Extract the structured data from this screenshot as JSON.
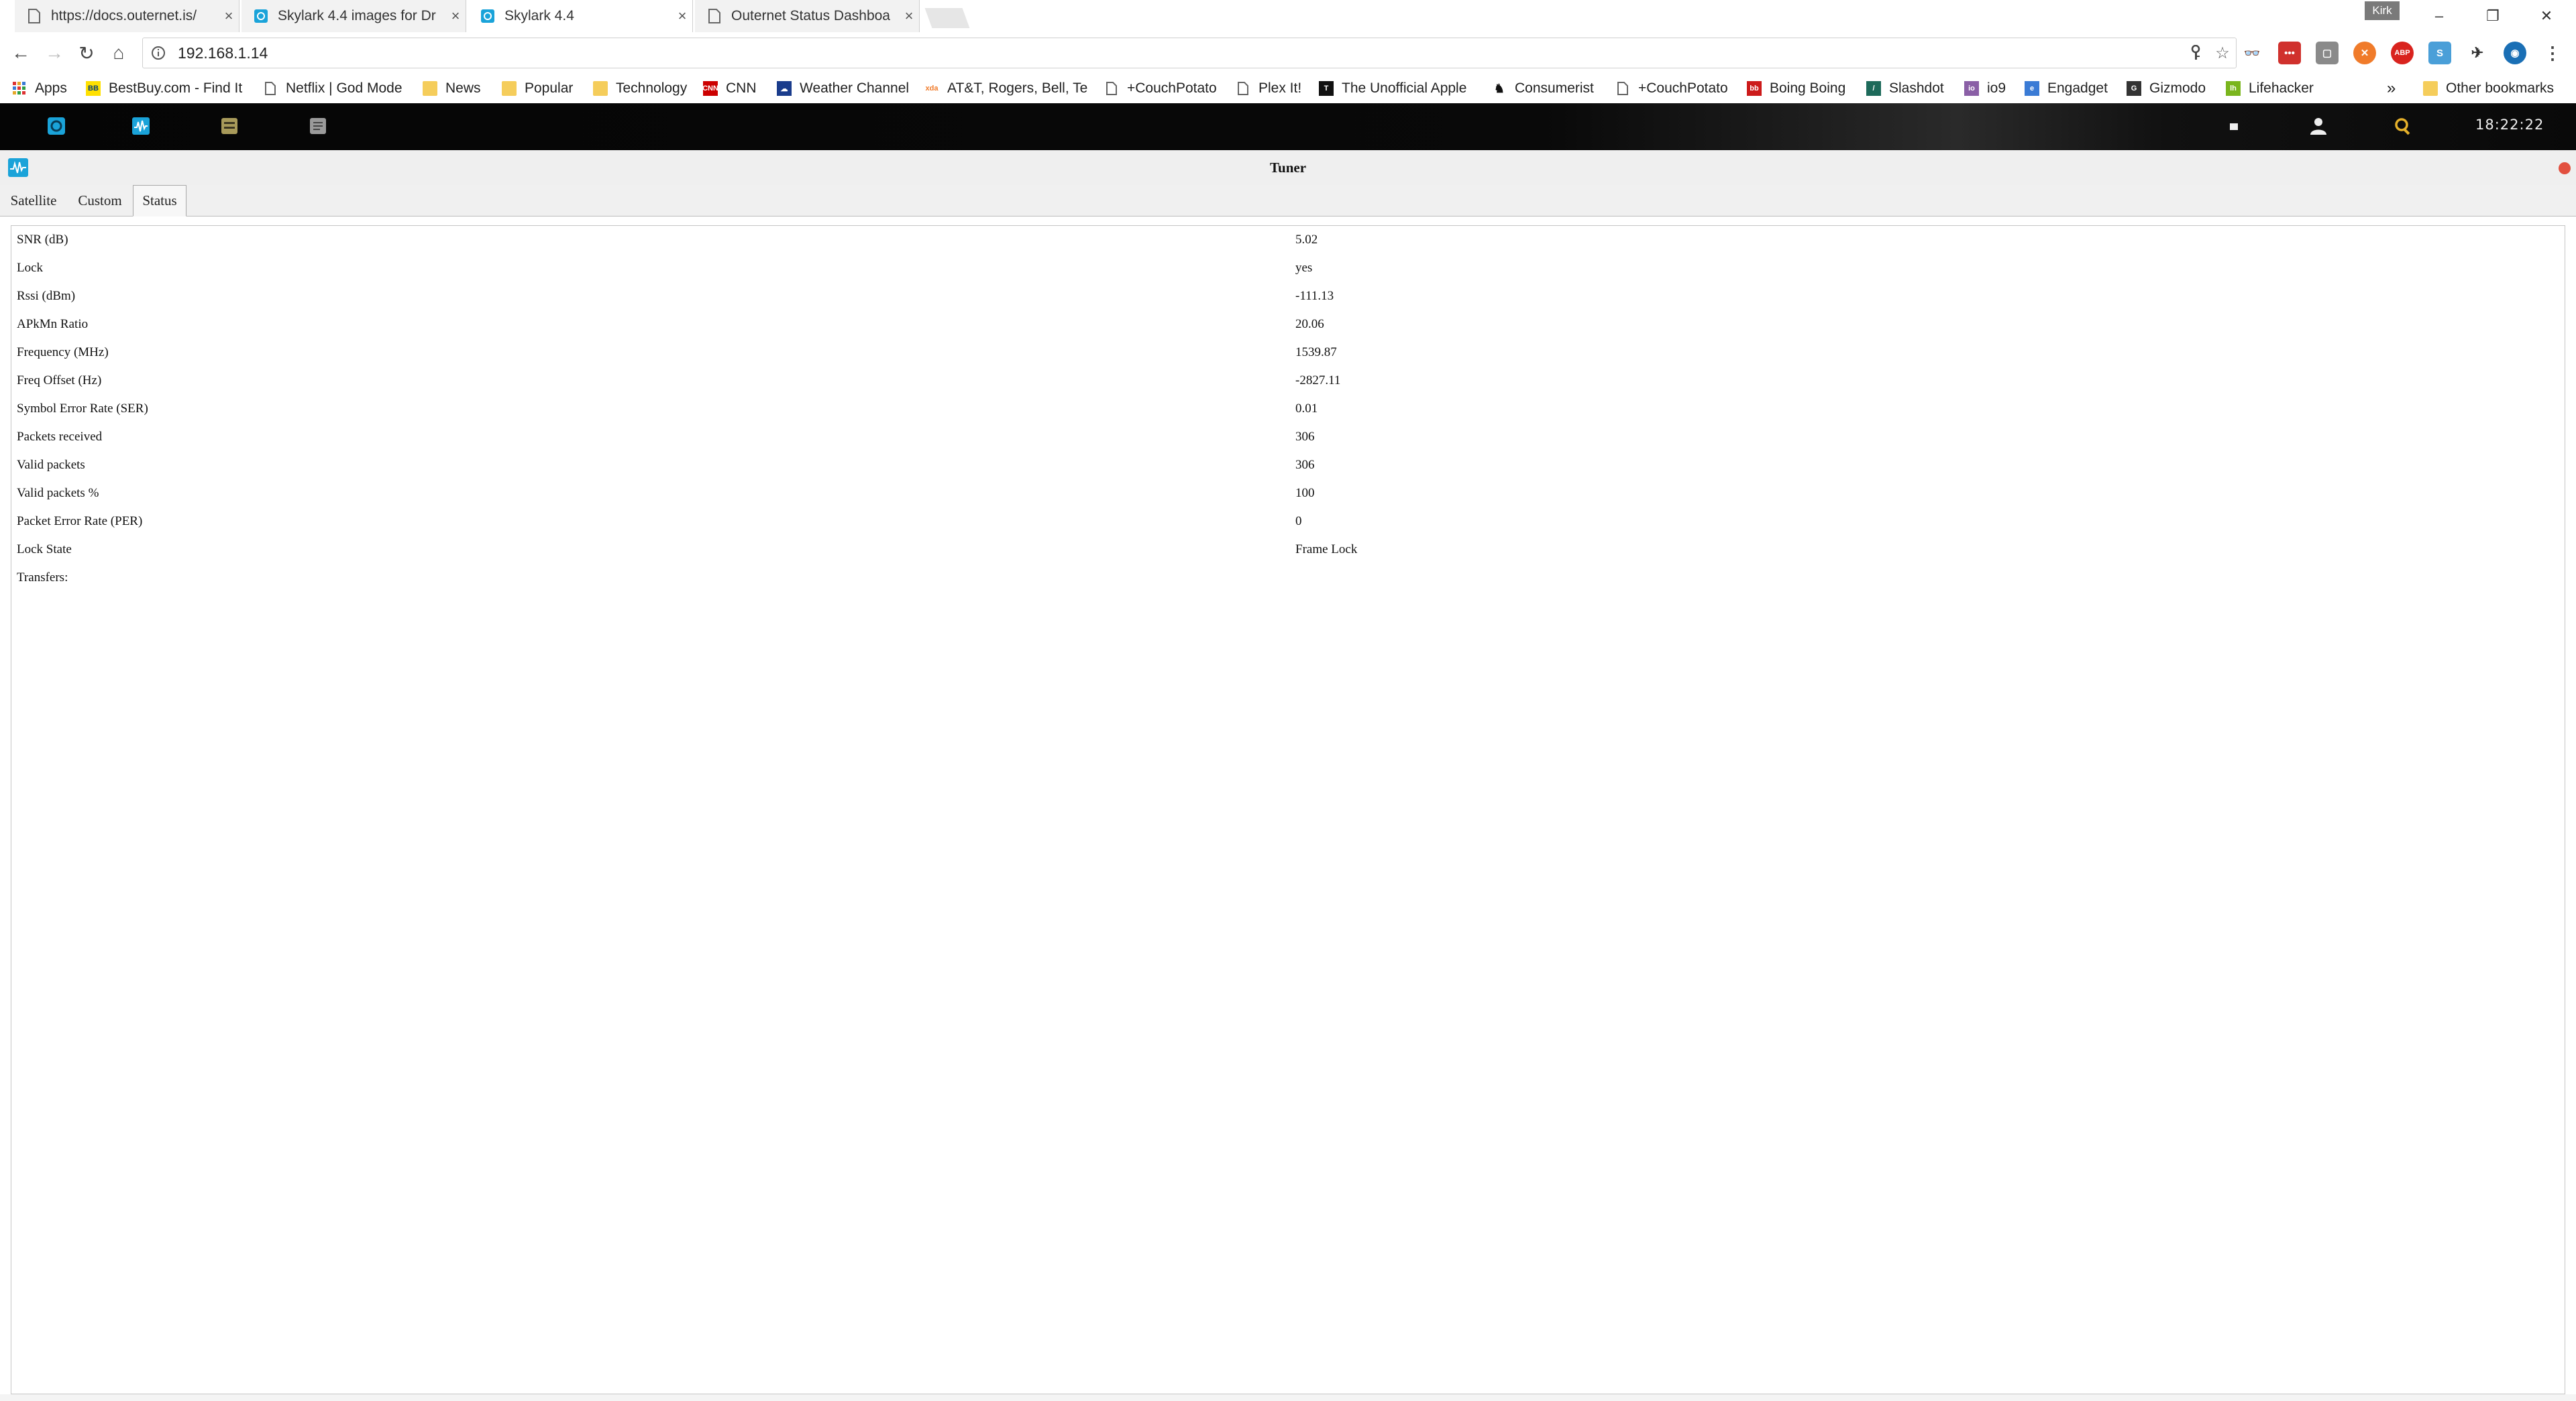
{
  "browser": {
    "tabs": [
      {
        "title": "https://docs.outernet.is/",
        "icon": "page-icon",
        "active": false
      },
      {
        "title": "Skylark 4.4 images for Dr",
        "icon": "skylark-icon",
        "active": false
      },
      {
        "title": "Skylark 4.4",
        "icon": "skylark-icon",
        "active": true
      },
      {
        "title": "Outernet Status Dashboa",
        "icon": "page-icon",
        "active": false
      }
    ],
    "profile_label": "Kirk",
    "address": "192.168.1.14",
    "bookmarks": [
      {
        "label": "Apps",
        "icon": "apps-grid-icon"
      },
      {
        "label": "BestBuy.com - Find It",
        "icon": "bestbuy-icon"
      },
      {
        "label": "Netflix | God Mode",
        "icon": "page-icon"
      },
      {
        "label": "News",
        "icon": "folder-icon"
      },
      {
        "label": "Popular",
        "icon": "folder-icon"
      },
      {
        "label": "Technology",
        "icon": "folder-icon"
      },
      {
        "label": "CNN",
        "icon": "cnn-icon"
      },
      {
        "label": "Weather Channel",
        "icon": "weather-icon"
      },
      {
        "label": "AT&T, Rogers, Bell, Te",
        "icon": "xda-icon"
      },
      {
        "label": "+CouchPotato",
        "icon": "page-icon"
      },
      {
        "label": "Plex It!",
        "icon": "page-icon"
      },
      {
        "label": "The Unofficial Apple",
        "icon": "apple-icon"
      },
      {
        "label": "Consumerist",
        "icon": "consumerist-icon"
      },
      {
        "label": "+CouchPotato",
        "icon": "page-icon"
      },
      {
        "label": "Boing Boing",
        "icon": "boingboing-icon"
      },
      {
        "label": "Slashdot",
        "icon": "slashdot-icon"
      },
      {
        "label": "io9",
        "icon": "io9-icon"
      },
      {
        "label": "Engadget",
        "icon": "engadget-icon"
      },
      {
        "label": "Gizmodo",
        "icon": "gizmodo-icon"
      },
      {
        "label": "Lifehacker",
        "icon": "lifehacker-icon"
      }
    ],
    "overflow_label": "»",
    "other_bookmarks": "Other bookmarks"
  },
  "appbar": {
    "clock": "18:22:22",
    "icons": [
      "home-icon",
      "tuner-icon",
      "files-icon",
      "notes-icon",
      "wifi-icon",
      "user-icon",
      "search-icon"
    ]
  },
  "tuner": {
    "title": "Tuner",
    "tabs": [
      "Satellite",
      "Custom",
      "Status"
    ],
    "active_tab": "Status",
    "rows": [
      {
        "label": "SNR (dB)",
        "value": "5.02"
      },
      {
        "label": "Lock",
        "value": "yes"
      },
      {
        "label": "Rssi (dBm)",
        "value": "-111.13"
      },
      {
        "label": "APkMn Ratio",
        "value": "20.06"
      },
      {
        "label": "Frequency (MHz)",
        "value": "1539.87"
      },
      {
        "label": "Freq Offset (Hz)",
        "value": "-2827.11"
      },
      {
        "label": "Symbol Error Rate (SER)",
        "value": "0.01"
      },
      {
        "label": "Packets received",
        "value": "306"
      },
      {
        "label": "Valid packets",
        "value": "306"
      },
      {
        "label": "Valid packets %",
        "value": "100"
      },
      {
        "label": "Packet Error Rate (PER)",
        "value": "0"
      },
      {
        "label": "Lock State",
        "value": "Frame Lock"
      },
      {
        "label": "Transfers:",
        "value": ""
      }
    ]
  },
  "colors": {
    "accent": "#1aa3d9",
    "appbar_bg": "#0a0a0a",
    "close_red": "#e2503f"
  }
}
